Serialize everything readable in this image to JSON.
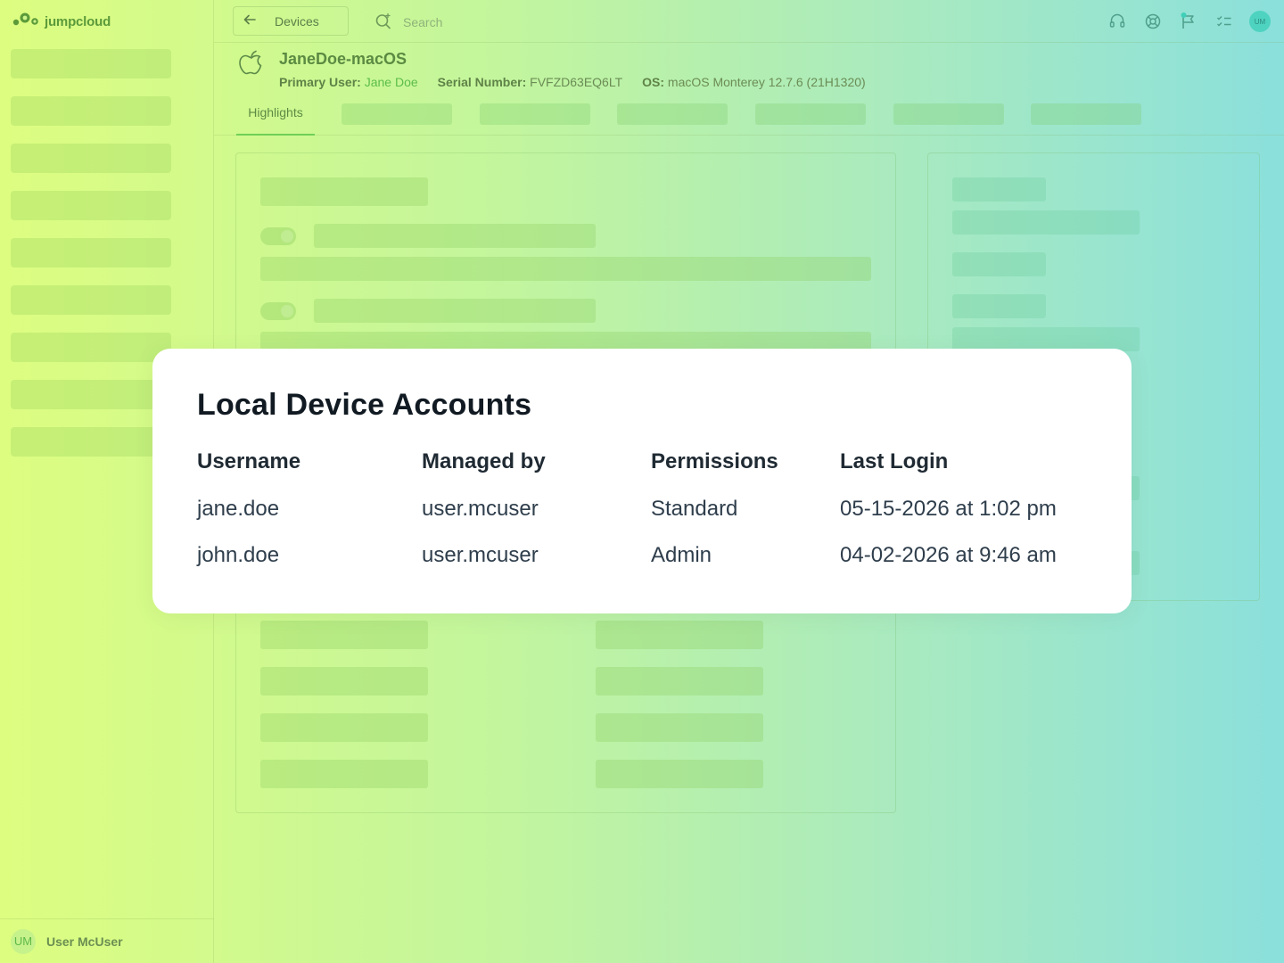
{
  "app": {
    "logo_text": "jumpcloud"
  },
  "sidebar": {
    "user_initials": "UM",
    "user_name": "User McUser"
  },
  "topbar": {
    "back_label": "Devices",
    "search_placeholder": "Search",
    "avatar_initials": "UM"
  },
  "device": {
    "name": "JaneDoe-macOS",
    "primary_user_label": "Primary User:",
    "primary_user_value": "Jane Doe",
    "serial_label": "Serial Number:",
    "serial_value": "FVFZD63EQ6LT",
    "os_label": "OS:",
    "os_value": "macOS Monterey 12.7.6 (21H1320)"
  },
  "tabs": {
    "active_label": "Highlights"
  },
  "modal": {
    "title": "Local Device Accounts",
    "headers": [
      "Username",
      "Managed by",
      "Permissions",
      "Last Login"
    ],
    "rows": [
      {
        "username": "jane.doe",
        "managed_by": "user.mcuser",
        "permissions": "Standard",
        "last_login": "05-15-2026 at 1:02 pm"
      },
      {
        "username": "john.doe",
        "managed_by": "user.mcuser",
        "permissions": "Admin",
        "last_login": "04-02-2026 at 9:46 am"
      }
    ]
  }
}
